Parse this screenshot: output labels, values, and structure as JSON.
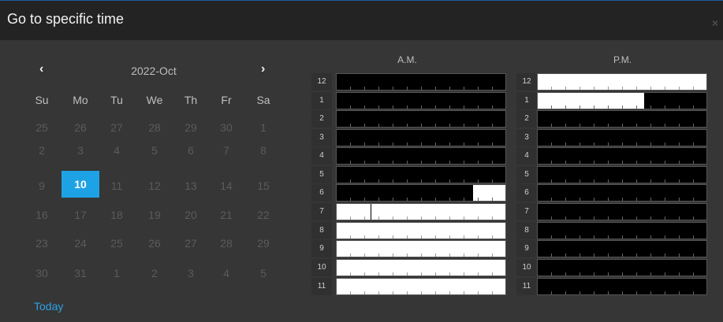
{
  "dialog": {
    "title": "Go to specific time",
    "close_glyph": "×"
  },
  "calendar": {
    "prev_glyph": "‹",
    "next_glyph": "›",
    "month_label": "2022-Oct",
    "weekdays": [
      "Su",
      "Mo",
      "Tu",
      "We",
      "Th",
      "Fr",
      "Sa"
    ],
    "weeks": [
      [
        "25",
        "26",
        "27",
        "28",
        "29",
        "30",
        "1"
      ],
      [
        "2",
        "3",
        "4",
        "5",
        "6",
        "7",
        "8"
      ],
      [
        "9",
        "10",
        "11",
        "12",
        "13",
        "14",
        "15"
      ],
      [
        "16",
        "17",
        "18",
        "19",
        "20",
        "21",
        "22"
      ],
      [
        "23",
        "24",
        "25",
        "26",
        "27",
        "28",
        "29"
      ],
      [
        "30",
        "31",
        "1",
        "2",
        "3",
        "4",
        "5"
      ]
    ],
    "selected_day": "10",
    "today_label": "Today"
  },
  "hours": {
    "am_label": "A.M.",
    "pm_label": "P.M.",
    "labels": [
      "12",
      "1",
      "2",
      "3",
      "4",
      "5",
      "6",
      "7",
      "8",
      "9",
      "10",
      "11"
    ],
    "am_recorded_fraction": [
      0,
      0,
      0,
      0,
      0,
      0,
      0.19,
      1,
      1,
      1,
      1,
      1
    ],
    "am_recorded_start": [
      0,
      0,
      0,
      0,
      0,
      0,
      0.81,
      0,
      0,
      0,
      0,
      0
    ],
    "pm_recorded_fraction": [
      1,
      0.63,
      0,
      0,
      0,
      0,
      0,
      0,
      0,
      0,
      0,
      0
    ],
    "pm_recorded_start": [
      0,
      0,
      0,
      0,
      0,
      0,
      0,
      0,
      0,
      0,
      0,
      0
    ],
    "am_divider_hour7_fraction": 0.2
  },
  "colors": {
    "accent": "#1ea2e6",
    "recorded": "#ffffff",
    "empty": "#000000"
  }
}
